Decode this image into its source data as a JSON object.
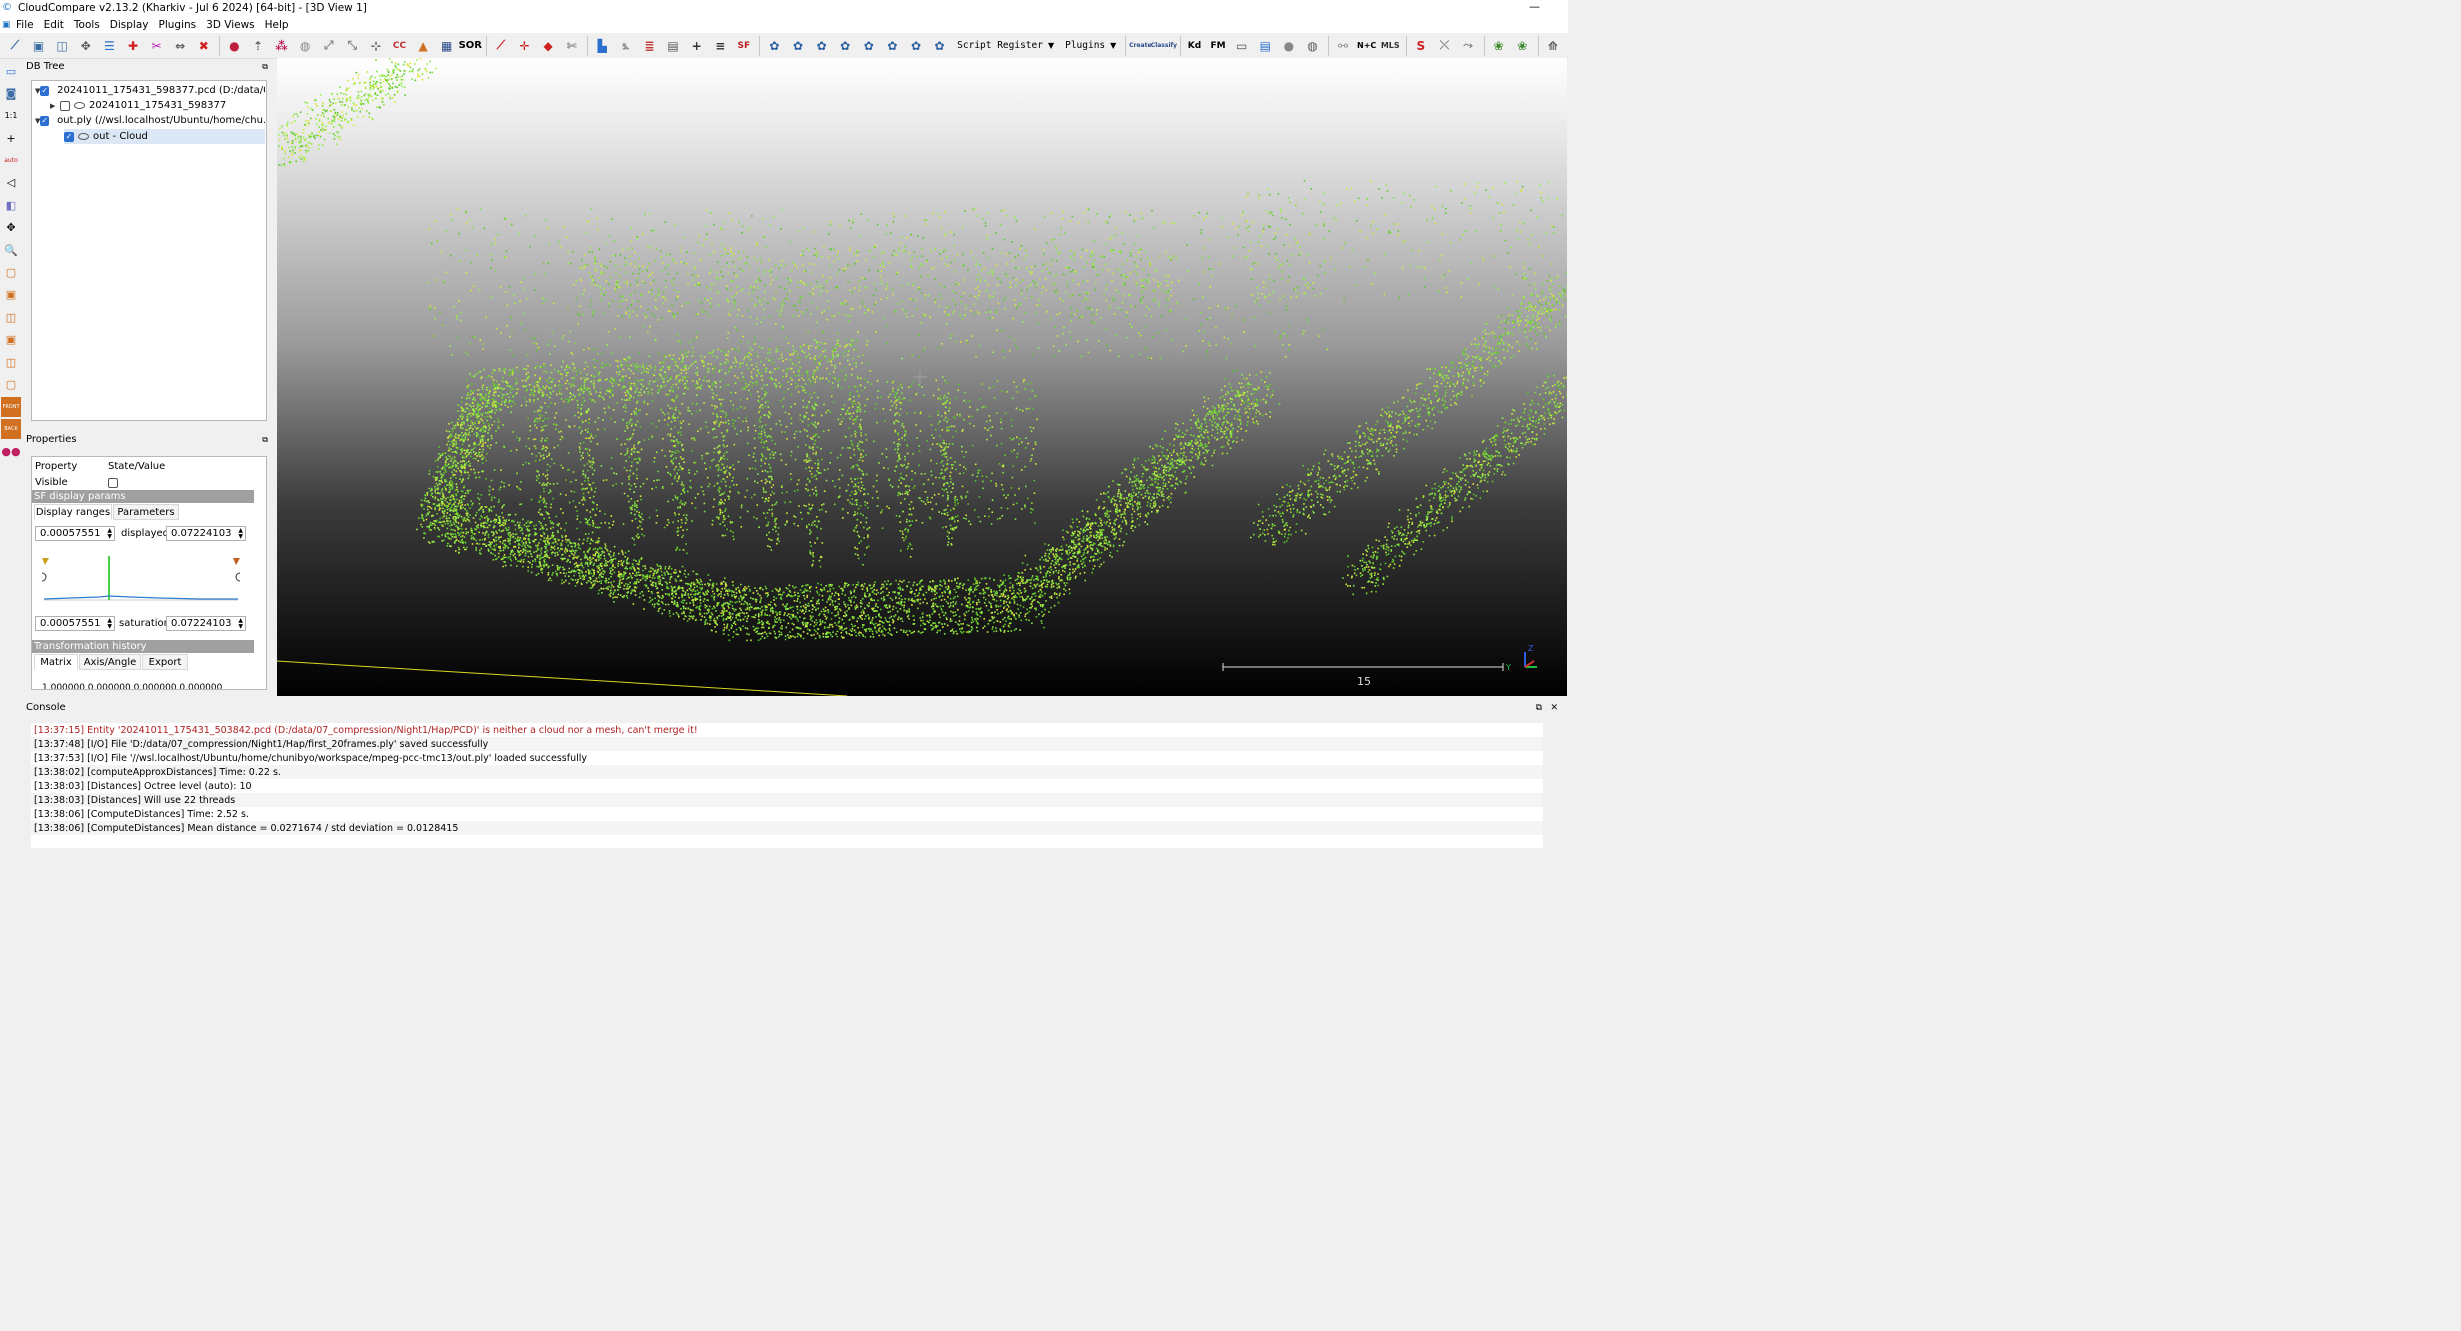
{
  "window": {
    "title": "CloudCompare v2.13.2 (Kharkiv - Jul  6 2024) [64-bit] - [3D View 1]",
    "minimize": "—"
  },
  "menu": [
    "File",
    "Edit",
    "Tools",
    "Display",
    "Plugins",
    "3D Views",
    "Help"
  ],
  "toolbar": {
    "script_register": "Script Register",
    "plugins": "Plugins",
    "sor_label": "SOR",
    "sf_label": "SF",
    "kd_label": "Kd",
    "fm_label": "FM",
    "mls_label": "MLS",
    "nc_label": "N+C",
    "canupo_create": "Create",
    "canupo_classify": "Classify"
  },
  "left_toolbar": {
    "scale_label": "1:1",
    "auto_label": "auto",
    "front_label": "FRONT",
    "back_label": "BACK"
  },
  "db_tree": {
    "title": "DB Tree",
    "items": [
      {
        "label": "20241011_175431_598377.pcd (D:/data/0...",
        "checked": true,
        "expanded": true,
        "type": "folder",
        "level": 0
      },
      {
        "label": "20241011_175431_598377",
        "checked": false,
        "expanded": false,
        "type": "cloud",
        "level": 1
      },
      {
        "label": "out.ply (//wsl.localhost/Ubuntu/home/chu...",
        "checked": true,
        "expanded": true,
        "type": "folder",
        "level": 0
      },
      {
        "label": "out - Cloud",
        "checked": true,
        "expanded": false,
        "type": "cloud",
        "level": 1,
        "selected": true
      }
    ]
  },
  "properties": {
    "title": "Properties",
    "header_property": "Property",
    "header_value": "State/Value",
    "visible_label": "Visible",
    "visible_checked": false,
    "sf_section": "SF display params",
    "tabs": [
      "Display ranges",
      "Parameters"
    ],
    "display_min": "0.00057551",
    "displayed_label": "displayed",
    "display_max": "0.07224103",
    "sat_min": "0.00057551",
    "saturation_label": "saturation",
    "sat_max": "0.07224103",
    "transform_section": "Transformation history",
    "transform_tabs": [
      "Matrix",
      "Axis/Angle",
      "Export"
    ],
    "matrix_row": "1.000000 0.000000 0.000000 0.000000"
  },
  "view3d": {
    "scale_value": "15",
    "axis_y": "Y",
    "axis_z": "Z"
  },
  "console": {
    "title": "Console",
    "lines": [
      {
        "text": "[13:37:15] Entity '20241011_175431_503842.pcd (D:/data/07_compression/Night1/Hap/PCD)' is neither a cloud nor a mesh, can't merge it!",
        "error": true
      },
      {
        "text": "[13:37:48] [I/O] File 'D:/data/07_compression/Night1/Hap/first_20frames.ply' saved successfully",
        "error": false
      },
      {
        "text": "[13:37:53] [I/O] File '//wsl.localhost/Ubuntu/home/chunibyo/workspace/mpeg-pcc-tmc13/out.ply' loaded successfully",
        "error": false
      },
      {
        "text": "[13:38:02] [computeApproxDistances] Time: 0.22 s.",
        "error": false
      },
      {
        "text": "[13:38:03] [Distances] Octree level (auto): 10",
        "error": false
      },
      {
        "text": "[13:38:03] [Distances] Will use 22 threads",
        "error": false
      },
      {
        "text": "[13:38:06] [ComputeDistances] Time: 2.52 s.",
        "error": false
      },
      {
        "text": "[13:38:06] [ComputeDistances] Mean distance = 0.0271674 / std deviation = 0.0128415",
        "error": false
      }
    ]
  },
  "colors": {
    "accent": "#2b6fd1",
    "cloud_green": "#7ee03a",
    "cloud_yellow": "#d6e83a",
    "error_text": "#b02020"
  }
}
